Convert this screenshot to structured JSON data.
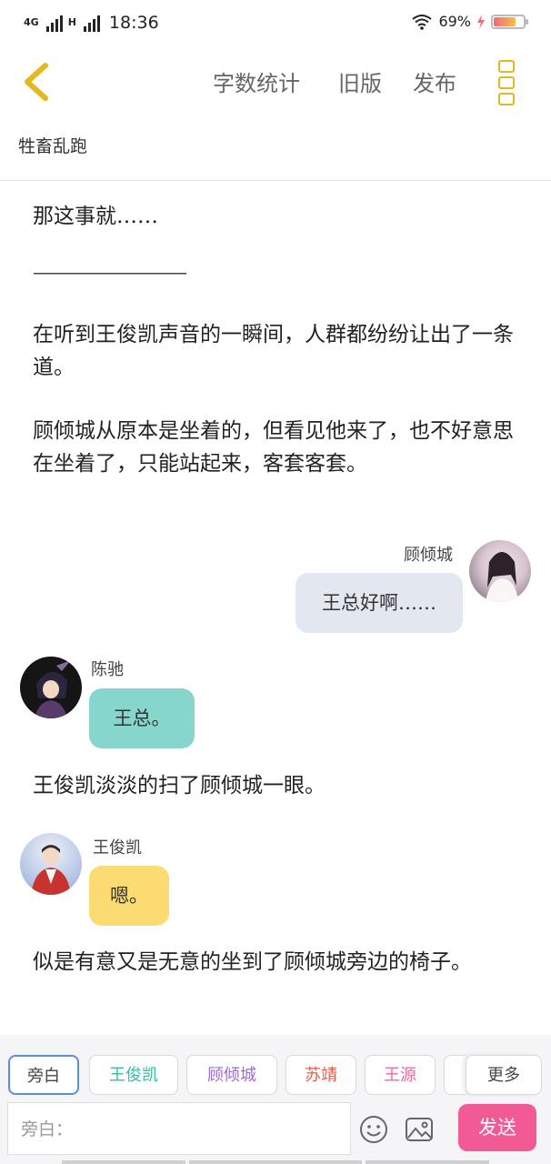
{
  "status_bar": {
    "network_1": "4G",
    "network_2": "H",
    "time": "18:36",
    "battery_level": "69%",
    "battery_fraction": 0.69
  },
  "topbar": {
    "menu": [
      "字数统计",
      "旧版",
      "发布"
    ]
  },
  "doc_title": "牲畜乱跑",
  "content": {
    "p1": "那这事就……",
    "p2": "————————",
    "p3": "在听到王俊凯声音的一瞬间，人群都纷纷让出了一条道。",
    "p4": "顾倾城从原本是坐着的，但看见他来了，也不好意思在坐着了，只能站起来，客套客套。",
    "msg1": {
      "name": "顾倾城",
      "text": "王总好啊……"
    },
    "msg2": {
      "name": "陈驰",
      "text": "王总。"
    },
    "p5": "王俊凯淡淡的扫了顾倾城一眼。",
    "msg3": {
      "name": "王俊凯",
      "text": "嗯。"
    },
    "p6": "似是有意又是无意的坐到了顾倾城旁边的椅子。"
  },
  "bottom": {
    "chips": [
      "旁白",
      "王俊凯",
      "顾倾城",
      "苏靖",
      "王源",
      "更多"
    ],
    "input_label": "旁白：",
    "send": "发送"
  },
  "colors": {
    "accent_yellow": "#e3b91f",
    "send_pink": "#f25a96",
    "bubble_blue": "#e3e8f0",
    "bubble_teal": "#86d6cd",
    "bubble_yellow": "#fbdb72"
  }
}
